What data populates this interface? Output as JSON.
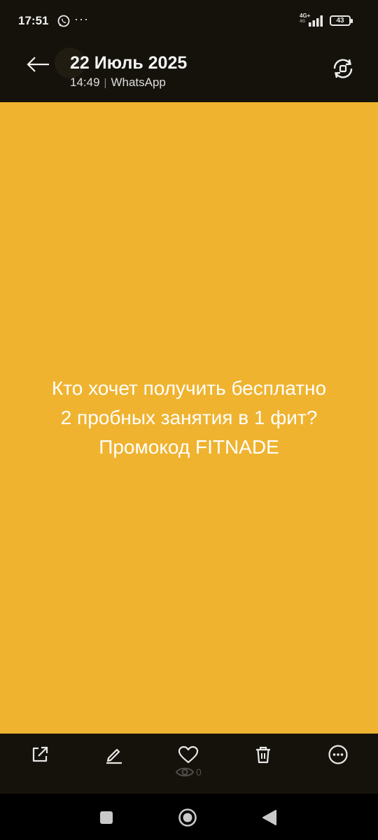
{
  "status_bar": {
    "time": "17:51",
    "more": "···",
    "network": "4G+",
    "network_sub": "4G",
    "battery": "43"
  },
  "header": {
    "title": "22 Июль 2025",
    "time": "14:49",
    "separator": "|",
    "source": "WhatsApp"
  },
  "status": {
    "text": "Кто хочет получить бесплатно\n2 пробных занятия в 1 фит?\nПромокод FITNADE",
    "background": "#efb32f"
  },
  "actions": {
    "views_count": "0"
  },
  "colors": {
    "bar_background": "#15120b",
    "status_background": "#efb32f"
  },
  "icons": {
    "back": "arrow-left-icon",
    "rotate": "rotate-icon",
    "share": "share-icon",
    "edit": "pencil-icon",
    "like": "heart-icon",
    "delete": "trash-icon",
    "more": "more-horizontal-icon",
    "views": "eye-icon",
    "nav_recents": "square-icon",
    "nav_home": "circle-icon",
    "nav_back": "triangle-icon"
  }
}
